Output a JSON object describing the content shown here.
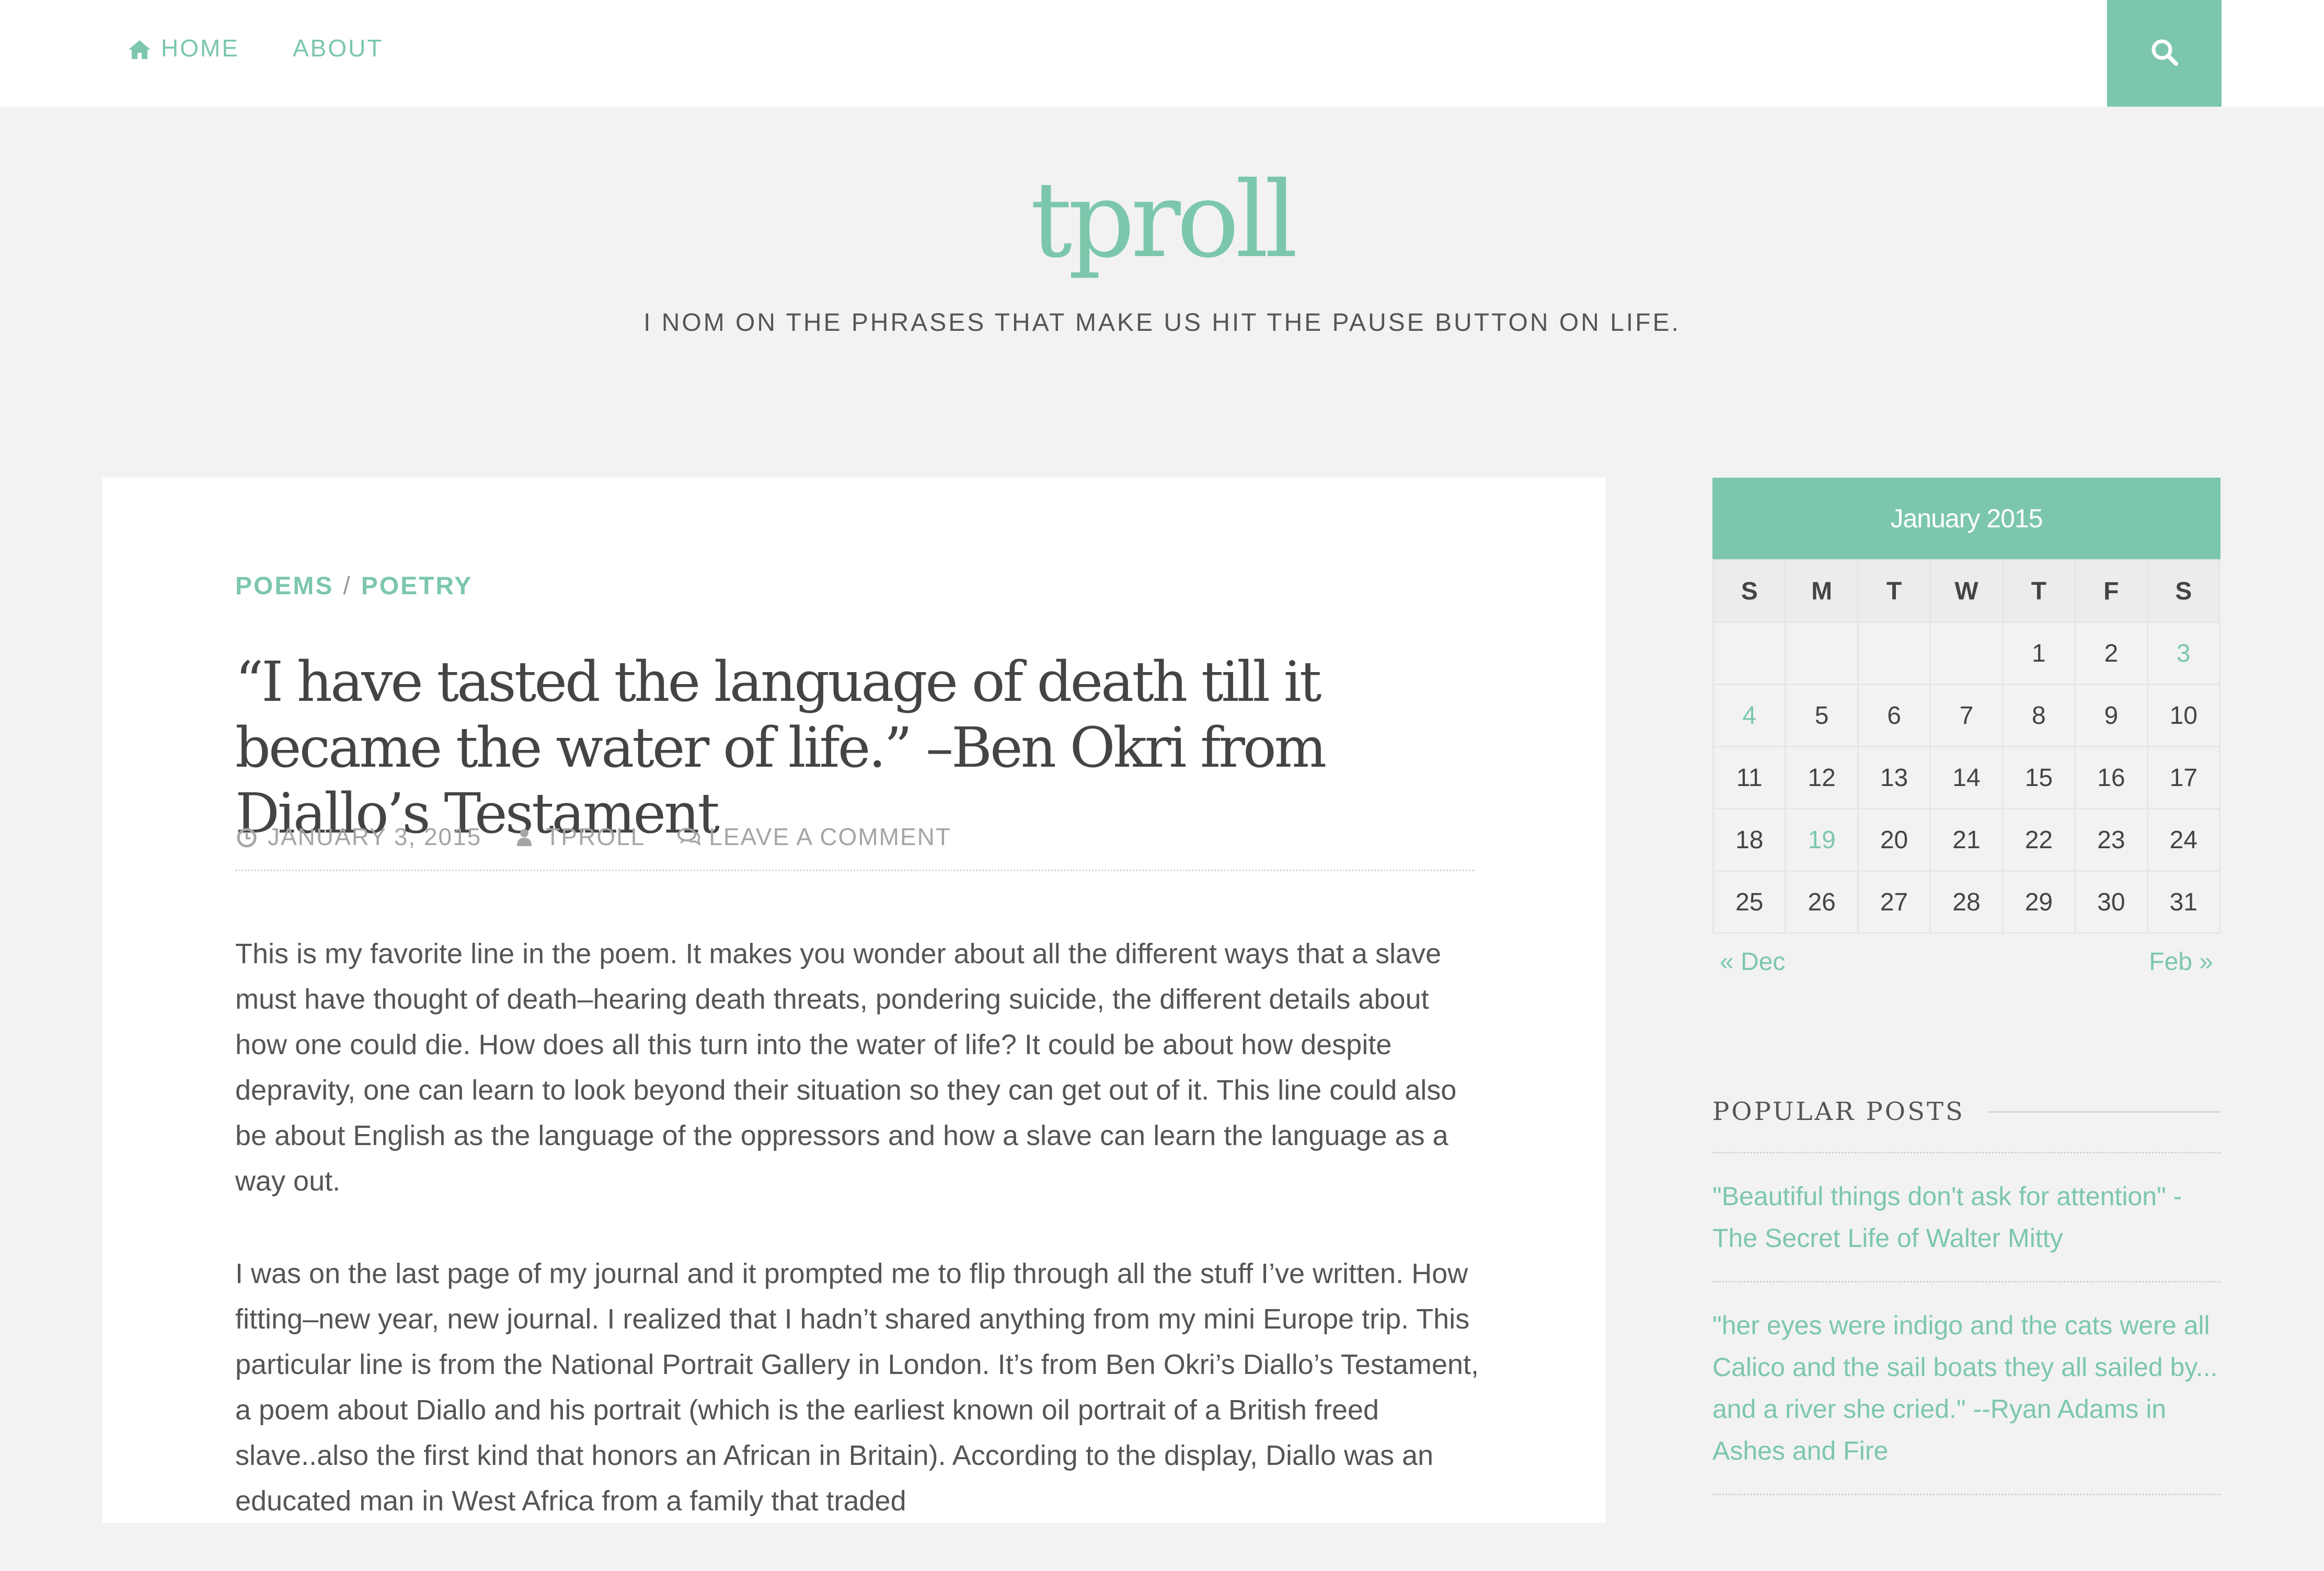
{
  "nav": {
    "items": [
      {
        "label": "HOME",
        "icon": "home-icon"
      },
      {
        "label": "ABOUT"
      }
    ],
    "search_icon": "search-icon"
  },
  "site": {
    "title": "tproll",
    "tagline": "I NOM ON THE PHRASES THAT MAKE US HIT THE PAUSE BUTTON ON LIFE."
  },
  "post": {
    "categories": [
      "POEMS",
      "POETRY"
    ],
    "category_separator": "/",
    "title": "“I have tasted the language of death till it became the water of life.” –Ben Okri from Diallo’s Testament",
    "meta": {
      "date": "JANUARY 3, 2015",
      "author": "TPROLL",
      "comments": "LEAVE A COMMENT"
    },
    "paragraphs": [
      "This is my favorite line in the poem. It makes you wonder about all the different ways that a slave must have thought of death–hearing death threats, pondering suicide, the different details about how one could die. How does all this turn into the water of life? It could be about how despite depravity, one can learn to look beyond their situation so they can get out of it. This line could also be about English as the language of the oppressors and how a slave can learn the language as a way out.",
      "I was on the last page of my journal and it prompted me to flip through all the stuff I’ve written. How fitting–new year, new journal. I realized that I hadn’t shared anything from my mini Europe trip. This particular line is from the National Portrait Gallery in London. It’s from Ben Okri’s Diallo’s Testament, a poem about Diallo and his portrait (which is the earliest known oil portrait of a British freed slave..also the first kind that honors an African in Britain). According to the display, Diallo was an educated man in West Africa from a family that traded"
    ]
  },
  "calendar": {
    "caption": "January 2015",
    "weekdays": [
      "S",
      "M",
      "T",
      "W",
      "T",
      "F",
      "S"
    ],
    "weeks": [
      [
        "",
        "",
        "",
        "",
        "1",
        "2",
        "3"
      ],
      [
        "4",
        "5",
        "6",
        "7",
        "8",
        "9",
        "10"
      ],
      [
        "11",
        "12",
        "13",
        "14",
        "15",
        "16",
        "17"
      ],
      [
        "18",
        "19",
        "20",
        "21",
        "22",
        "23",
        "24"
      ],
      [
        "25",
        "26",
        "27",
        "28",
        "29",
        "30",
        "31"
      ]
    ],
    "linked_days": [
      "3",
      "4",
      "19"
    ],
    "prev": "« Dec",
    "next": "Feb »"
  },
  "popular_posts": {
    "title": "POPULAR POSTS",
    "items": [
      "\"Beautiful things don't ask for attention\" - The Secret Life of Walter Mitty",
      "\"her eyes were indigo and the cats were all Calico and the sail boats they all sailed by... and a river she cried.\" --Ryan Adams in Ashes and Fire"
    ]
  },
  "colors": {
    "accent": "#7cc7ab",
    "background": "#f2f2f2",
    "text": "#555555"
  }
}
